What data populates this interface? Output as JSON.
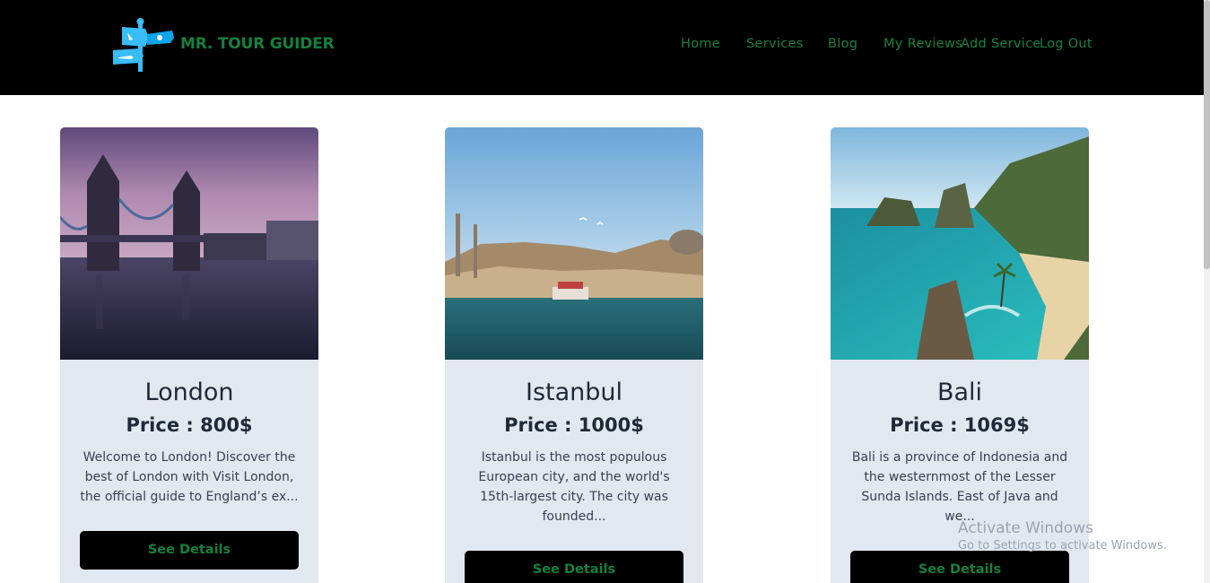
{
  "navbar": {
    "brand": "MR. TOUR GUIDER",
    "logo_icon": "signpost-icon",
    "links": {
      "home": "Home",
      "services": "Services",
      "blog": "Blog",
      "reviews": "My Reviews",
      "add_service": "Add Service",
      "logout": "Log Out"
    },
    "accent_color": "#15803d",
    "background_color": "#000000"
  },
  "cards": [
    {
      "title": "London",
      "price": "Price : 800$",
      "description": "Welcome to London! Discover the best of London with Visit London, the official guide to England’s ex...",
      "button": "See Details"
    },
    {
      "title": "Istanbul",
      "price": "Price : 1000$",
      "description": "Istanbul is the most populous European city, and the world's 15th-largest city. The city was founded...",
      "button": "See Details"
    },
    {
      "title": "Bali",
      "price": "Price : 1069$",
      "description": "Bali is a province of Indonesia and the westernmost of the Lesser Sunda Islands. East of Java and we...",
      "button": "See Details"
    }
  ],
  "watermark": {
    "title": "Activate Windows",
    "subtitle": "Go to Settings to activate Windows."
  }
}
